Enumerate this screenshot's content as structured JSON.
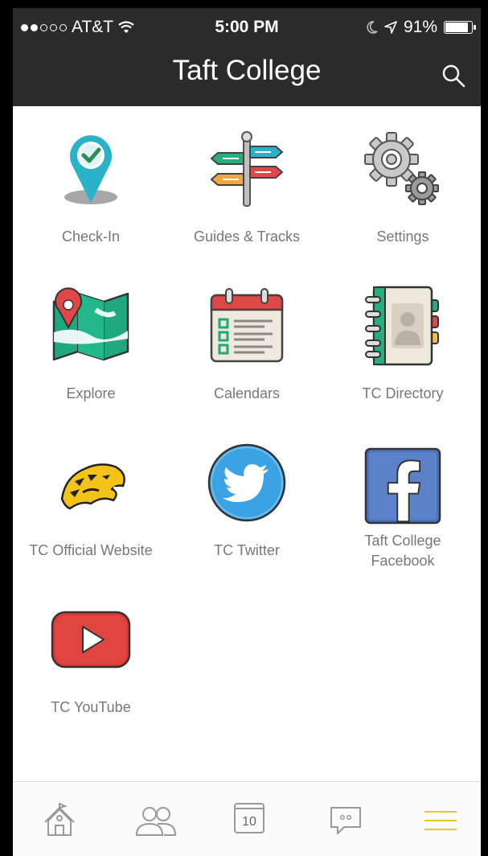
{
  "status": {
    "carrier": "AT&T",
    "time": "5:00 PM",
    "battery": "91%",
    "battery_level": 0.91
  },
  "nav": {
    "title": "Taft College"
  },
  "tiles": [
    {
      "label": "Check-In",
      "icon": "check-in-pin-icon"
    },
    {
      "label": "Guides & Tracks",
      "icon": "signpost-icon"
    },
    {
      "label": "Settings",
      "icon": "gears-icon"
    },
    {
      "label": "Explore",
      "icon": "map-icon"
    },
    {
      "label": "Calendars",
      "icon": "calendar-icon"
    },
    {
      "label": "TC Directory",
      "icon": "address-book-icon"
    },
    {
      "label": "TC Official Website",
      "icon": "tiger-logo-icon"
    },
    {
      "label": "TC Twitter",
      "icon": "twitter-bird-icon"
    },
    {
      "label_line1": "Taft College",
      "label_line2": "Facebook",
      "icon": "facebook-icon"
    },
    {
      "label": "TC YouTube",
      "icon": "youtube-icon"
    }
  ],
  "tabbar": {
    "calendar_day": "10",
    "active_tab": "menu"
  },
  "colors": {
    "bar": "#2b2b2b",
    "accent": "#f0c419",
    "label": "#777777"
  }
}
